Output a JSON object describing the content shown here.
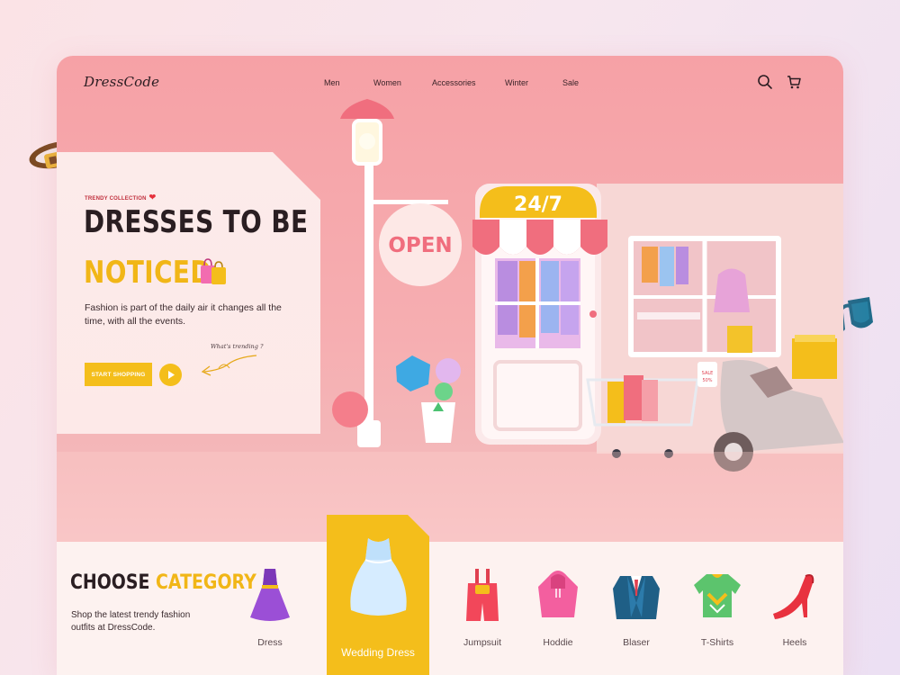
{
  "brand": {
    "logo": "DressCode"
  },
  "nav": {
    "items": [
      "Men",
      "Women",
      "Accessories",
      "Winter",
      "Sale"
    ],
    "icons": [
      "search-icon",
      "cart-icon"
    ]
  },
  "hero": {
    "eyebrow": "TRENDY COLLECTION",
    "title_line1": "DRESSES TO BE",
    "title_line2": "NOTICED.",
    "description": "Fashion is part of the daily air it changes all the time, with all the events.",
    "trending_note": "What's trending ?",
    "cta_label": "START SHOPPING",
    "play_icon": "play-icon"
  },
  "scene": {
    "store_sign": "24/7",
    "open_sign": "OPEN",
    "sale_tag": "SALE 50%"
  },
  "category": {
    "title_part1": "CHOOSE",
    "title_part2": "CATEGORY",
    "description": "Shop the latest trendy fashion outfits at DressCode.",
    "items": [
      {
        "label": "Dress"
      },
      {
        "label": "Wedding Dress",
        "active": true
      },
      {
        "label": "Jumpsuit"
      },
      {
        "label": "Hoddie"
      },
      {
        "label": "Blaser"
      },
      {
        "label": "T-Shirts"
      },
      {
        "label": "Heels"
      }
    ]
  },
  "colors": {
    "accent": "#F4BE1B",
    "primary_pink": "#F6A1A6",
    "heading": "#2A1E22",
    "panel": "#FDF2F0"
  }
}
